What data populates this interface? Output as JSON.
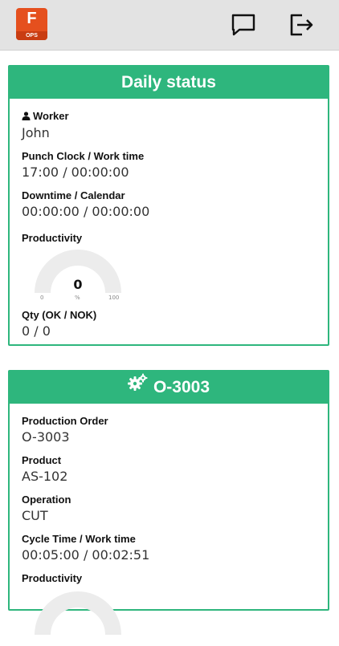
{
  "app": {
    "logo_letter": "F",
    "logo_sub": "OPS"
  },
  "header": {
    "chat_icon": "chat-icon",
    "logout_icon": "logout-icon"
  },
  "daily": {
    "title": "Daily status",
    "worker_label": "Worker",
    "worker_value": "John",
    "punch_label": "Punch Clock / Work time",
    "punch_value": "17:00 / 00:00:00",
    "downtime_label": "Downtime / Calendar",
    "downtime_value": "00:00:00 / 00:00:00",
    "productivity_label": "Productivity",
    "gauge": {
      "value": "0",
      "min": "0",
      "unit": "%",
      "max": "100",
      "level": 0
    },
    "qty_label": "Qty (OK / NOK)",
    "qty_value": "0 / 0"
  },
  "order": {
    "title": "O-3003",
    "po_label": "Production Order",
    "po_value": "O-3003",
    "product_label": "Product",
    "product_value": "AS-102",
    "operation_label": "Operation",
    "operation_value": "CUT",
    "cycle_label": "Cycle Time / Work time",
    "cycle_value": "00:05:00 / 00:02:51",
    "productivity_label": "Productivity"
  },
  "colors": {
    "accent": "#2eb67d",
    "logo": "#e5501e"
  }
}
